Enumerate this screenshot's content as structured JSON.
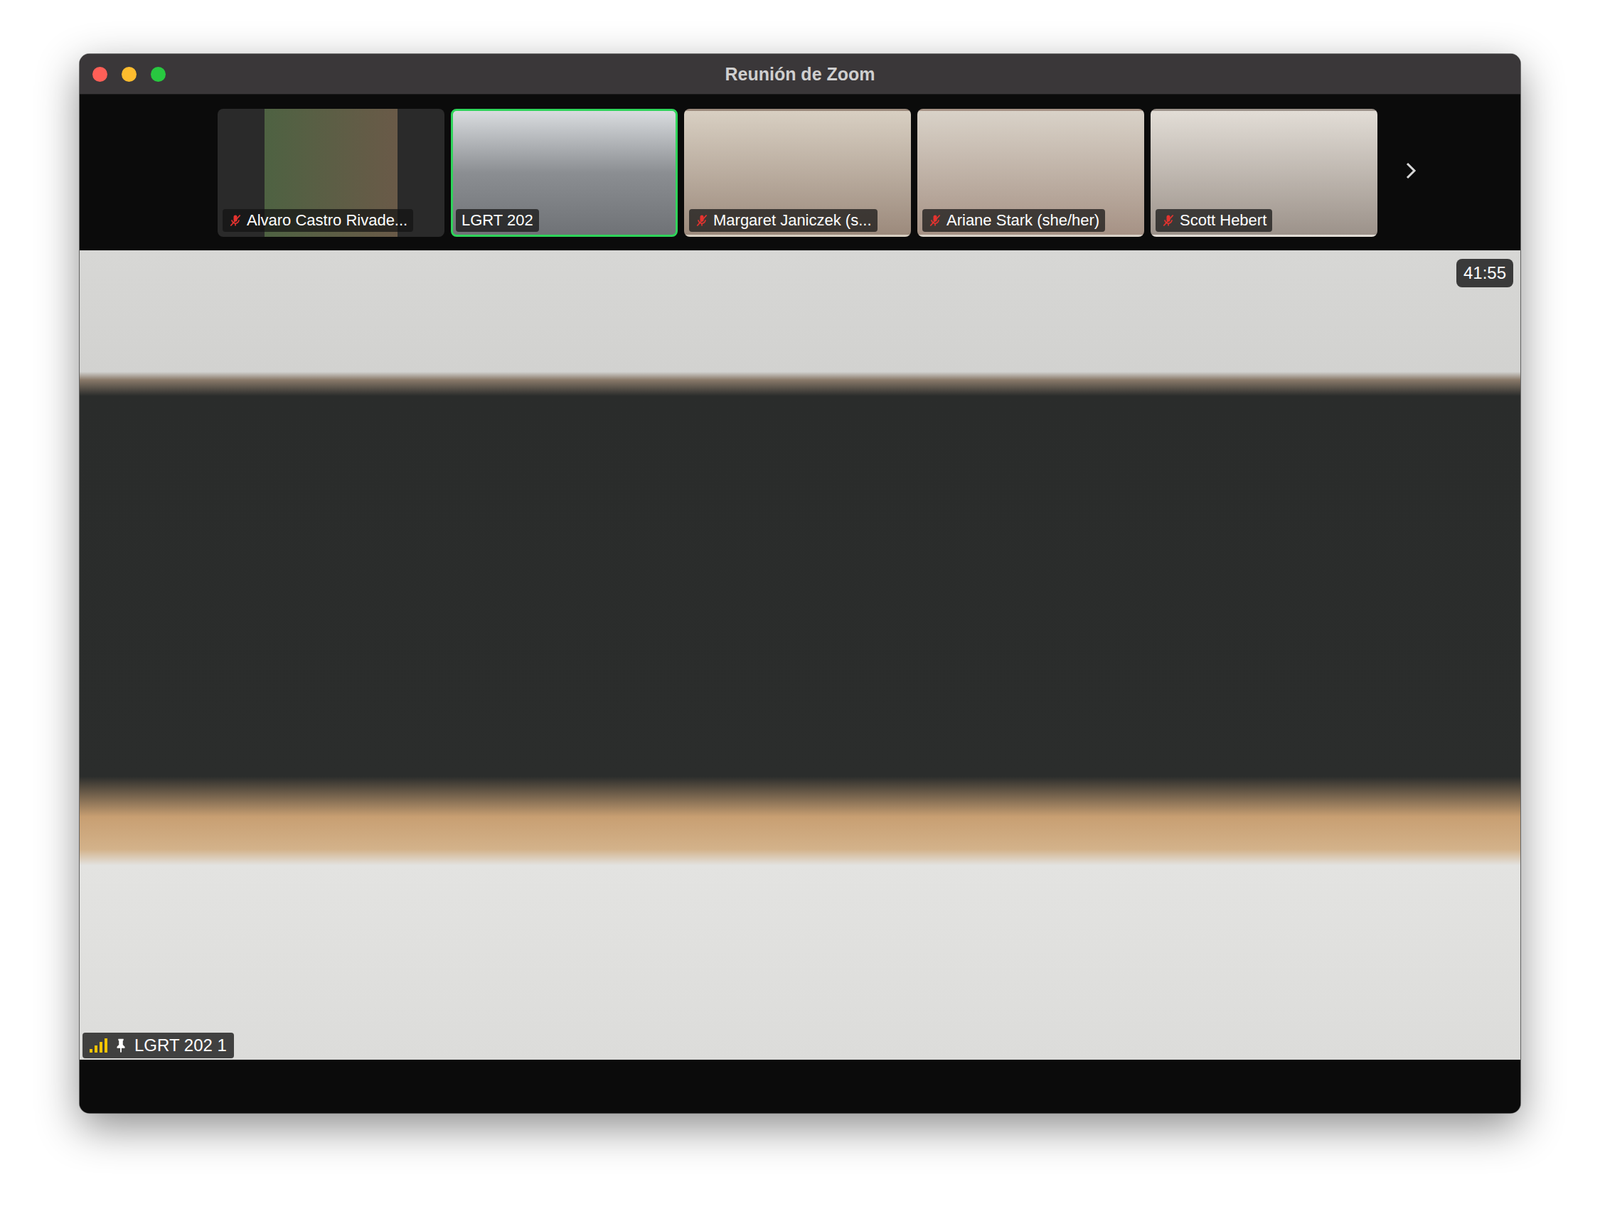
{
  "window": {
    "title": "Reunión de Zoom"
  },
  "participants": [
    {
      "name": "Alvaro Castro Rivade...",
      "muted": true,
      "selected": false
    },
    {
      "name": "LGRT 202",
      "muted": false,
      "selected": true
    },
    {
      "name": "Margaret Janiczek (s...",
      "muted": true,
      "selected": false
    },
    {
      "name": "Ariane Stark (she/her)",
      "muted": true,
      "selected": false
    },
    {
      "name": "Scott Hebert",
      "muted": true,
      "selected": false
    }
  ],
  "main_video": {
    "name": "LGRT 202 1",
    "pinned": true,
    "signal_level": 1,
    "timer": "41:55"
  }
}
